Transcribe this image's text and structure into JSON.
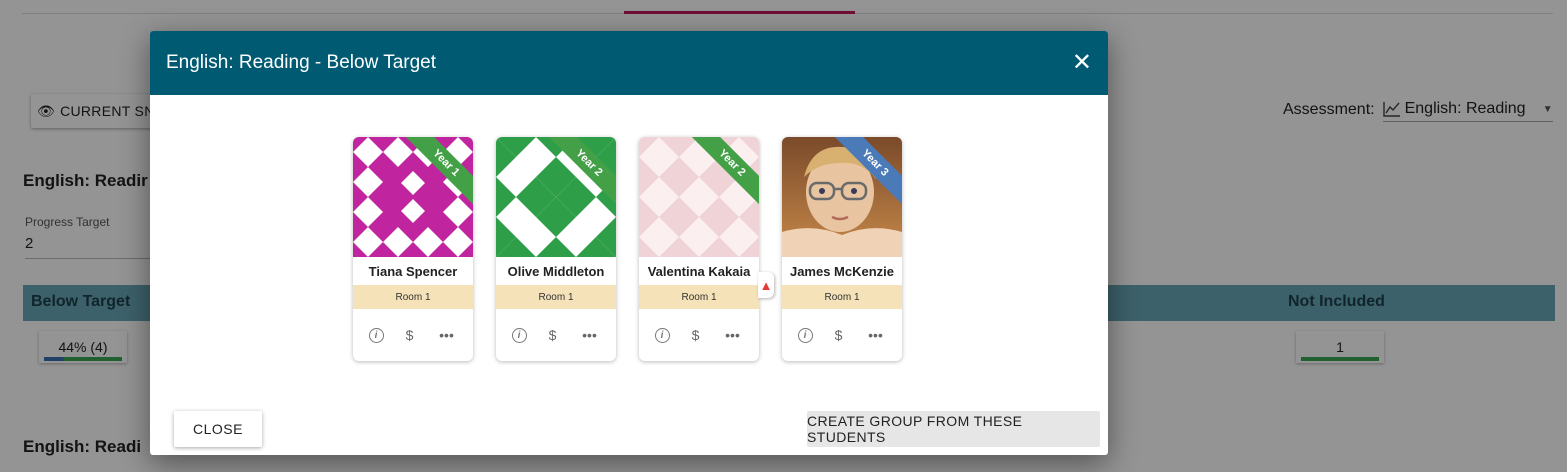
{
  "background": {
    "snapshot_button_label": "CURRENT SNA",
    "assessment_label": "Assessment:",
    "assessment_value": "English: Reading",
    "section_title_1": "English: Readir",
    "section_title_2": "English: Readi",
    "progress_target_label": "Progress Target",
    "progress_target_value": "2",
    "band_left_label": "Below Target",
    "band_right_label": "Not Included",
    "stat_left": "44% (4)",
    "stat_right": "1"
  },
  "modal": {
    "title": "English: Reading - Below Target",
    "close_label": "CLOSE",
    "create_group_label": "CREATE GROUP FROM THESE STUDENTS",
    "students": [
      {
        "name": "Tiana Spencer",
        "year": "Year 1",
        "room": "Room 1",
        "pattern_color": "#c0249f",
        "ribbon_color": "#43a047"
      },
      {
        "name": "Olive Middleton",
        "year": "Year 2",
        "room": "Room 1",
        "pattern_color": "#2e9e48",
        "ribbon_color": "#43a047"
      },
      {
        "name": "Valentina Kakaia",
        "year": "Year 2",
        "room": "Room 1",
        "pattern_color": "#efd3d6",
        "ribbon_color": "#43a047"
      },
      {
        "name": "James McKenzie",
        "year": "Year 3",
        "room": "Room 1",
        "pattern_color": "photo",
        "ribbon_color": "#4a7ab8"
      }
    ]
  },
  "colors": {
    "header": "#005a72",
    "band": "#6aa7b7",
    "room_bg": "#f5e2b8",
    "tab_accent": "#c2185b"
  }
}
